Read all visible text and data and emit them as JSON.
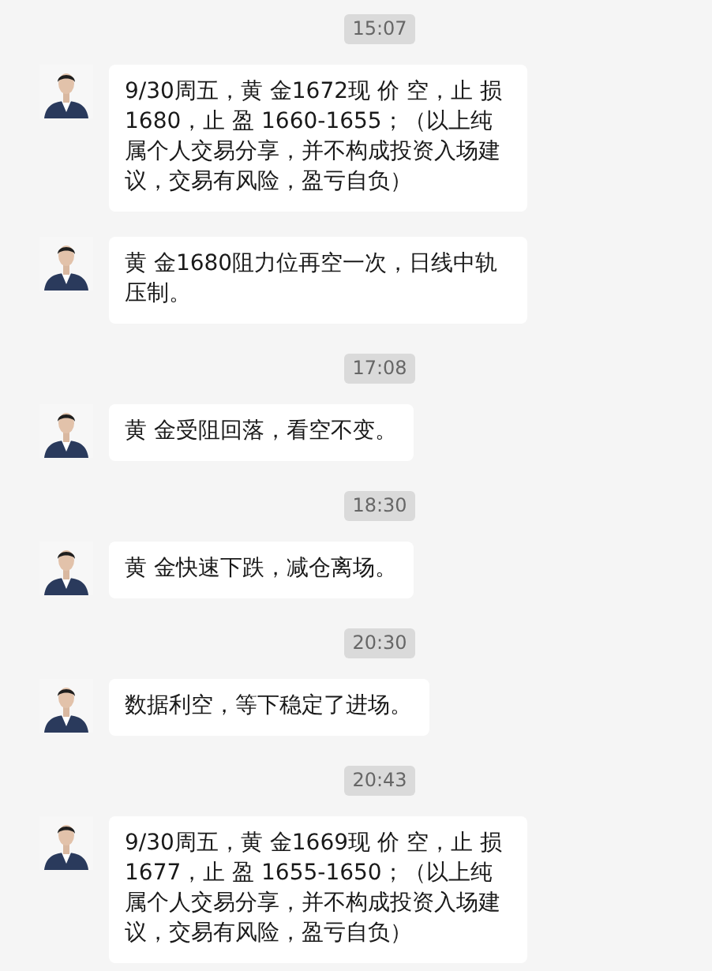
{
  "chat": [
    {
      "kind": "time",
      "text": "15:07"
    },
    {
      "kind": "message",
      "text": "9/30周五，黄 金1672现 价 空，止 损 1680，止 盈 1660-1655；（以上纯属个人交易分享，并不构成投资入场建议，交易有风险，盈亏自负）"
    },
    {
      "kind": "message",
      "text": "黄 金1680阻力位再空一次，日线中轨压制。"
    },
    {
      "kind": "time",
      "text": "17:08"
    },
    {
      "kind": "message",
      "text": "黄 金受阻回落，看空不变。"
    },
    {
      "kind": "time",
      "text": "18:30"
    },
    {
      "kind": "message",
      "text": "黄 金快速下跌，减仓离场。"
    },
    {
      "kind": "time",
      "text": "20:30"
    },
    {
      "kind": "message",
      "text": "数据利空，等下稳定了进场。"
    },
    {
      "kind": "time",
      "text": "20:43"
    },
    {
      "kind": "message",
      "text": "9/30周五，黄 金1669现 价 空，止 损 1677，止 盈 1655-1650；（以上纯属个人交易分享，并不构成投资入场建议，交易有风险，盈亏自负）"
    }
  ]
}
